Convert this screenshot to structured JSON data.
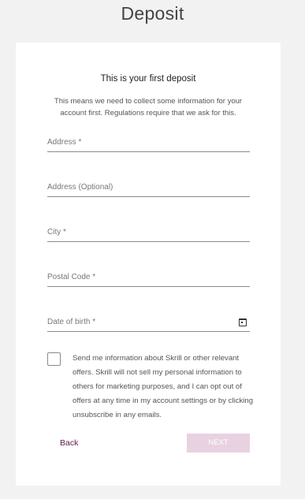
{
  "page": {
    "title": "Deposit"
  },
  "card": {
    "heading": "This is your first deposit",
    "subtitle": "This means we need to collect some information for your account first. Regulations require that we ask for this."
  },
  "form": {
    "fields": [
      {
        "label": "Address *",
        "value": ""
      },
      {
        "label": "Address (Optional)",
        "value": ""
      },
      {
        "label": "City *",
        "value": ""
      },
      {
        "label": "Postal Code *",
        "value": ""
      },
      {
        "label": "Date of birth *",
        "value": "",
        "icon": "calendar-icon"
      }
    ],
    "consent": {
      "checked": false,
      "text": "Send me information about Skrill or other relevant offers. Skrill will not sell my personal information to others for marketing purposes, and I can opt out of offers at any time in my account settings or by clicking unsubscribe in any emails."
    }
  },
  "actions": {
    "back_label": "Back",
    "next_label": "NEXT",
    "next_enabled": false
  },
  "colors": {
    "background": "#f2f2f2",
    "card": "#ffffff",
    "accent": "#5b1b4f",
    "next_disabled": "#e8d2e2"
  }
}
